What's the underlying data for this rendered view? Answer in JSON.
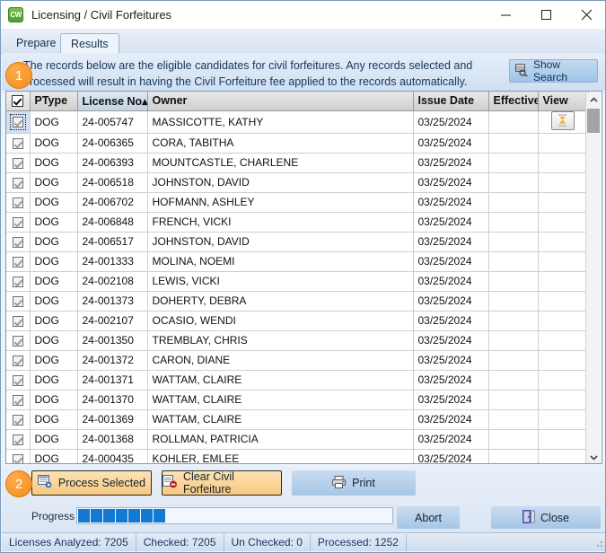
{
  "window": {
    "title": "Licensing / Civil Forfeitures",
    "app_icon": "cw-app-icon",
    "app_icon_text": "CW",
    "minimize_label": "—",
    "maximize_label": "□",
    "close_label": "✕"
  },
  "tabs": [
    {
      "label": "Prepare",
      "active": false
    },
    {
      "label": "Results",
      "active": true
    }
  ],
  "banner": {
    "text": "The records below are the eligible candidates for civil forfeitures.  Any records selected and processed will result in having the Civil Forfeiture fee applied to the records automatically.",
    "show_search_label": "Show Search"
  },
  "badges": [
    {
      "label": "1"
    },
    {
      "label": "2"
    }
  ],
  "grid": {
    "columns": [
      {
        "key": "checkbox",
        "label": "",
        "sorted": false
      },
      {
        "key": "ptype",
        "label": "PType",
        "sorted": false
      },
      {
        "key": "license",
        "label": "License No",
        "sorted": true,
        "sort_arrow": "▴"
      },
      {
        "key": "owner",
        "label": "Owner",
        "sorted": false
      },
      {
        "key": "issue_date",
        "label": "Issue Date",
        "sorted": false
      },
      {
        "key": "effective_date",
        "label": "Effective Date",
        "sorted": false
      },
      {
        "key": "view",
        "label": "View",
        "sorted": false
      }
    ],
    "header_checkbox_checked": true,
    "rows": [
      {
        "checked": true,
        "selected": true,
        "ptype": "DOG",
        "license": "24-005747",
        "owner": "MASSICOTTE, KATHY",
        "issue_date": "03/25/2024",
        "effective_date": "",
        "view_button": true
      },
      {
        "checked": true,
        "selected": false,
        "ptype": "DOG",
        "license": "24-006365",
        "owner": "CORA, TABITHA",
        "issue_date": "03/25/2024",
        "effective_date": "",
        "view_button": false
      },
      {
        "checked": true,
        "selected": false,
        "ptype": "DOG",
        "license": "24-006393",
        "owner": "MOUNTCASTLE, CHARLENE",
        "issue_date": "03/25/2024",
        "effective_date": "",
        "view_button": false
      },
      {
        "checked": true,
        "selected": false,
        "ptype": "DOG",
        "license": "24-006518",
        "owner": "JOHNSTON, DAVID",
        "issue_date": "03/25/2024",
        "effective_date": "",
        "view_button": false
      },
      {
        "checked": true,
        "selected": false,
        "ptype": "DOG",
        "license": "24-006702",
        "owner": "HOFMANN, ASHLEY",
        "issue_date": "03/25/2024",
        "effective_date": "",
        "view_button": false
      },
      {
        "checked": true,
        "selected": false,
        "ptype": "DOG",
        "license": "24-006848",
        "owner": "FRENCH, VICKI",
        "issue_date": "03/25/2024",
        "effective_date": "",
        "view_button": false
      },
      {
        "checked": true,
        "selected": false,
        "ptype": "DOG",
        "license": "24-006517",
        "owner": "JOHNSTON, DAVID",
        "issue_date": "03/25/2024",
        "effective_date": "",
        "view_button": false
      },
      {
        "checked": true,
        "selected": false,
        "ptype": "DOG",
        "license": "24-001333",
        "owner": "MOLINA, NOEMI",
        "issue_date": "03/25/2024",
        "effective_date": "",
        "view_button": false
      },
      {
        "checked": true,
        "selected": false,
        "ptype": "DOG",
        "license": "24-002108",
        "owner": "LEWIS, VICKI",
        "issue_date": "03/25/2024",
        "effective_date": "",
        "view_button": false
      },
      {
        "checked": true,
        "selected": false,
        "ptype": "DOG",
        "license": "24-001373",
        "owner": "DOHERTY, DEBRA",
        "issue_date": "03/25/2024",
        "effective_date": "",
        "view_button": false
      },
      {
        "checked": true,
        "selected": false,
        "ptype": "DOG",
        "license": "24-002107",
        "owner": "OCASIO, WENDI",
        "issue_date": "03/25/2024",
        "effective_date": "",
        "view_button": false
      },
      {
        "checked": true,
        "selected": false,
        "ptype": "DOG",
        "license": "24-001350",
        "owner": "TREMBLAY, CHRIS",
        "issue_date": "03/25/2024",
        "effective_date": "",
        "view_button": false
      },
      {
        "checked": true,
        "selected": false,
        "ptype": "DOG",
        "license": "24-001372",
        "owner": "CARON, DIANE",
        "issue_date": "03/25/2024",
        "effective_date": "",
        "view_button": false
      },
      {
        "checked": true,
        "selected": false,
        "ptype": "DOG",
        "license": "24-001371",
        "owner": "WATTAM, CLAIRE",
        "issue_date": "03/25/2024",
        "effective_date": "",
        "view_button": false
      },
      {
        "checked": true,
        "selected": false,
        "ptype": "DOG",
        "license": "24-001370",
        "owner": "WATTAM, CLAIRE",
        "issue_date": "03/25/2024",
        "effective_date": "",
        "view_button": false
      },
      {
        "checked": true,
        "selected": false,
        "ptype": "DOG",
        "license": "24-001369",
        "owner": "WATTAM, CLAIRE",
        "issue_date": "03/25/2024",
        "effective_date": "",
        "view_button": false
      },
      {
        "checked": true,
        "selected": false,
        "ptype": "DOG",
        "license": "24-001368",
        "owner": "ROLLMAN, PATRICIA",
        "issue_date": "03/25/2024",
        "effective_date": "",
        "view_button": false
      },
      {
        "checked": true,
        "selected": false,
        "ptype": "DOG",
        "license": "24-000435",
        "owner": "KOHLER, EMLEE",
        "issue_date": "03/25/2024",
        "effective_date": "",
        "view_button": false
      }
    ]
  },
  "actions": {
    "process_selected_label": "Process Selected",
    "clear_civil_forfeiture_label": "Clear Civil Forfeiture",
    "print_label": "Print",
    "abort_label": "Abort",
    "close_label": "Close",
    "progress_label": "Progress",
    "progress_chunks": 7
  },
  "status": [
    "Licenses Analyzed: 7205",
    "Checked: 7205",
    "Un Checked: 0",
    "Processed: 1252"
  ],
  "colors": {
    "accent_blue": "#1479d0",
    "sorted_column": "#a8cbec",
    "badge_orange": "#f08c1a",
    "action_button_orange": "#f6c97f"
  }
}
